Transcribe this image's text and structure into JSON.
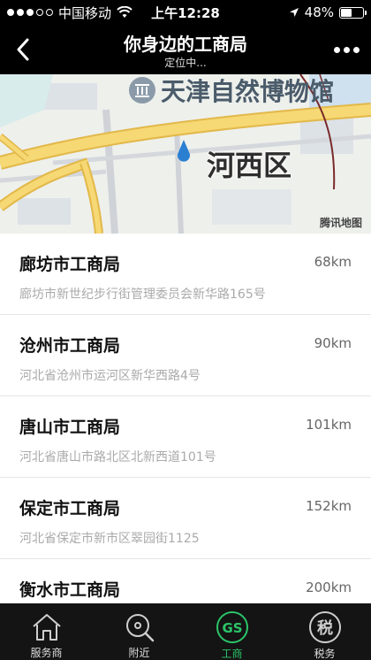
{
  "status_bar": {
    "carrier": "中国移动",
    "time": "上午12:28",
    "battery": "48%",
    "battery_level": 0.48
  },
  "nav": {
    "title": "你身边的工商局",
    "subtitle": "定位中..."
  },
  "map": {
    "poi_label": "天津自然博物馆",
    "district_label": "河西区",
    "credit": "腾讯地图",
    "colors": {
      "road_main": "#f6d874",
      "road_outline": "#e2b84a",
      "block": "#c9cfd6",
      "rail": "#7a2a2a",
      "pin": "#2a7fd1"
    }
  },
  "list": {
    "items": [
      {
        "name": "廊坊市工商局",
        "distance": "68km",
        "address": "廊坊市新世纪步行街管理委员会新华路165号"
      },
      {
        "name": "沧州市工商局",
        "distance": "90km",
        "address": "河北省沧州市运河区新华西路4号"
      },
      {
        "name": "唐山市工商局",
        "distance": "101km",
        "address": "河北省唐山市路北区北新西道101号"
      },
      {
        "name": "保定市工商局",
        "distance": "152km",
        "address": "河北省保定市新市区翠园街1125"
      },
      {
        "name": "衡水市工商局",
        "distance": "200km",
        "address": ""
      }
    ]
  },
  "tabs": [
    {
      "label": "服务商",
      "icon": "house-icon",
      "active": false
    },
    {
      "label": "附近",
      "icon": "search-icon",
      "active": false
    },
    {
      "label": "工商",
      "icon": "business-seal-icon",
      "active": true,
      "icon_text": "GS"
    },
    {
      "label": "税务",
      "icon": "tax-icon",
      "active": false,
      "icon_text": "税"
    }
  ],
  "colors": {
    "active_tab": "#2bc468",
    "nav_bg": "#000000",
    "tab_bg": "#141414"
  }
}
